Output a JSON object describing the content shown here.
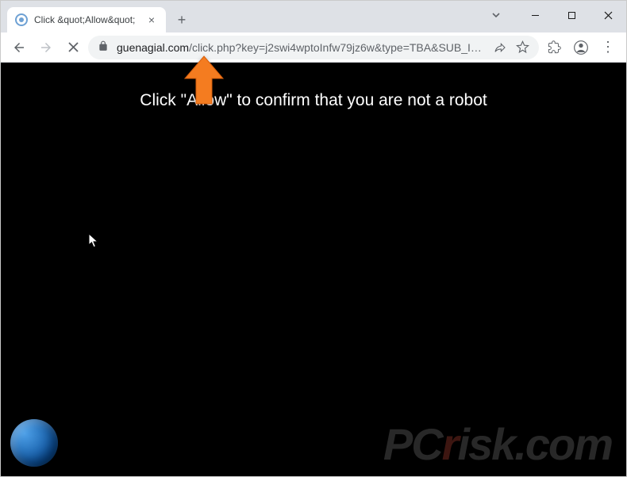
{
  "tab": {
    "title": "Click &quot;Allow&quot;",
    "favicon": "spinner-icon"
  },
  "url": {
    "domain": "guenagial.com",
    "path": "/click.php?key=j2swi4wptoInfw79jz6w&type=TBA&SUB_ID_SHORT=cnsl..."
  },
  "page": {
    "message": "Click \"Allow\" to confirm that you are not a robot"
  },
  "watermark": {
    "prefix": "PC",
    "red": "r",
    "suffix": "isk.com"
  },
  "icons": {
    "close_tab": "×",
    "new_tab": "+",
    "chevron_down": "⌄",
    "menu": "⋮"
  }
}
